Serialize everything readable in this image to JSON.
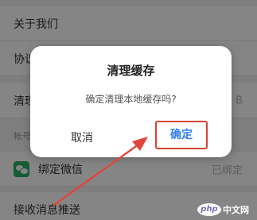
{
  "settings": {
    "about_label": "关于我们",
    "protocol_label": "协议",
    "cache_label": "清理缓存",
    "cache_value": "B",
    "section_label": "帐号",
    "wechat_label": "绑定微信",
    "wechat_status": "已绑定",
    "push_label": "接收消息推送"
  },
  "dialog": {
    "title": "清理缓存",
    "message": "确定清理本地缓存吗?",
    "cancel_label": "取消",
    "confirm_label": "确定"
  },
  "annotation": {
    "color": "#e0463b",
    "highlight_color": "#d64533"
  },
  "watermark": {
    "logo": "php",
    "text": "中文网"
  },
  "icons": {
    "wechat": "wechat-icon"
  }
}
